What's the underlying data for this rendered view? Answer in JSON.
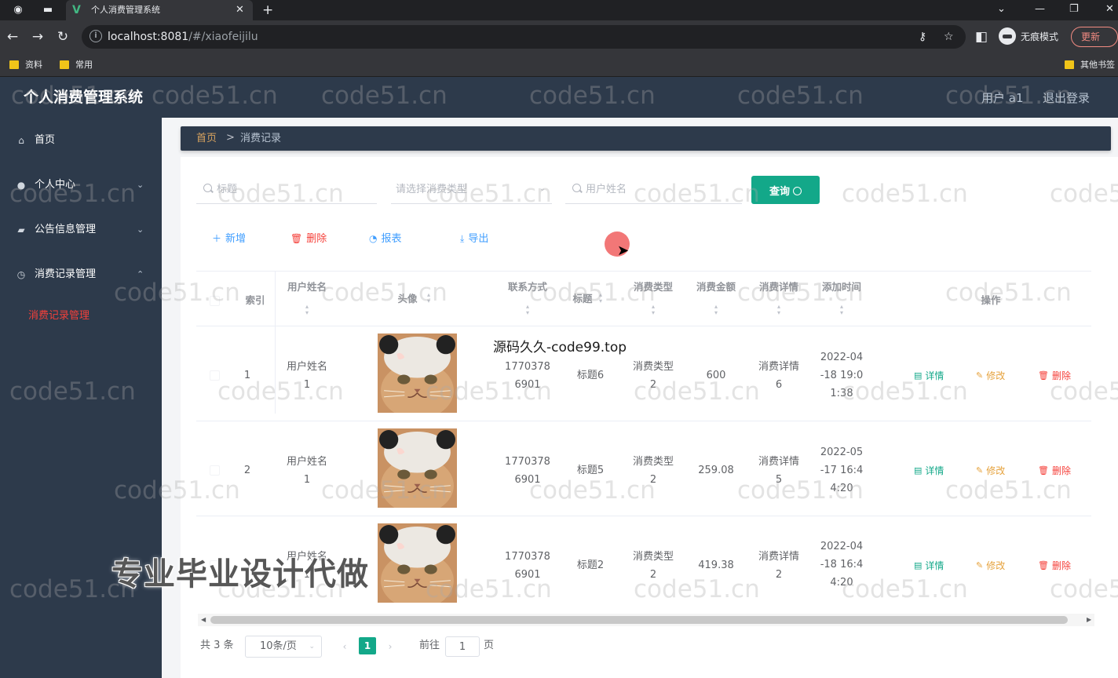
{
  "browser": {
    "tab_title": "个人消费管理系统",
    "tab_logo": "V",
    "url_host": "localhost:8081",
    "url_path": "/#/xiaofeijilu",
    "incognito_label": "无痕模式",
    "update_label": "更新",
    "bookmarks": [
      "资料",
      "常用"
    ],
    "other_bookmarks": "其他书签"
  },
  "header": {
    "title": "个人消费管理系统",
    "user": "用户 a1",
    "logout": "退出登录"
  },
  "sidebar": {
    "items": [
      {
        "label": "首页",
        "icon": "home-icon"
      },
      {
        "label": "个人中心",
        "icon": "user-icon"
      },
      {
        "label": "公告信息管理",
        "icon": "briefcase-icon"
      },
      {
        "label": "消费记录管理",
        "icon": "clock-icon"
      }
    ],
    "active_sub": "消费记录管理"
  },
  "breadcrumb": {
    "home": "首页",
    "separator": ">",
    "current": "消费记录"
  },
  "search": {
    "title_placeholder": "标题",
    "type_placeholder": "请选择消费类型",
    "username_placeholder": "用户姓名",
    "query_label": "查询"
  },
  "actions": {
    "add": "新增",
    "delete": "删除",
    "report": "报表",
    "export": "导出"
  },
  "table": {
    "headers": {
      "index": "索引",
      "username": "用户姓名",
      "avatar": "头像",
      "contact": "联系方式",
      "title": "标题",
      "type": "消费类型",
      "amount": "消费金额",
      "detail": "消费详情",
      "added": "添加时间",
      "ops": "操作"
    },
    "rows": [
      {
        "index": "1",
        "username": [
          "用户姓名",
          "1"
        ],
        "contact": [
          "1770378",
          "6901"
        ],
        "title": "标题6",
        "type": [
          "消费类型",
          "2"
        ],
        "amount": "600",
        "detail": [
          "消费详情",
          "6"
        ],
        "added": [
          "2022-04",
          "-18 19:0",
          "1:38"
        ]
      },
      {
        "index": "2",
        "username": [
          "用户姓名",
          "1"
        ],
        "contact": [
          "1770378",
          "6901"
        ],
        "title": "标题5",
        "type": [
          "消费类型",
          "2"
        ],
        "amount": "259.08",
        "detail": [
          "消费详情",
          "5"
        ],
        "added": [
          "2022-05",
          "-17 16:4",
          "4:20"
        ]
      },
      {
        "index": "3",
        "username": [
          "用户姓名",
          "1"
        ],
        "contact": [
          "1770378",
          "6901"
        ],
        "title": "标题2",
        "type": [
          "消费类型",
          "2"
        ],
        "amount": "419.38",
        "detail": [
          "消费详情",
          "2"
        ],
        "added": [
          "2022-04",
          "-18 16:4",
          "4:20"
        ]
      }
    ],
    "row_actions": {
      "detail": "详情",
      "edit": "修改",
      "delete": "删除"
    }
  },
  "pagination": {
    "total": "共 3 条",
    "page_size": "10条/页",
    "current_page": "1",
    "goto_label": "前往",
    "goto_value": "1",
    "page_unit": "页"
  },
  "overlay": {
    "watermark": "code51.cn",
    "promo_text": "源码久久-code99.top",
    "promo_banner": "专业毕业设计代做"
  },
  "colors": {
    "sidebar_bg": "#2d3a4b",
    "accent": "#13a889",
    "danger": "#f5403a",
    "breadcrumb_home": "#d8a35f"
  }
}
